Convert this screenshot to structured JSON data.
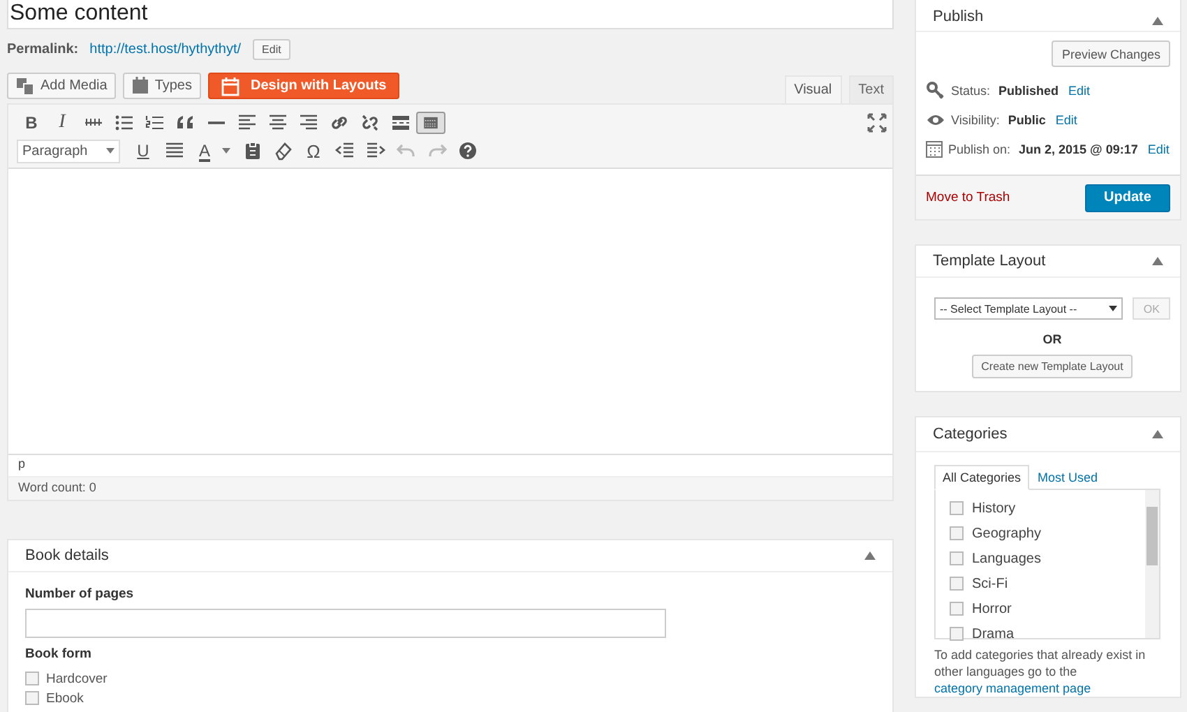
{
  "title_field": {
    "value": "Some content"
  },
  "permalink": {
    "label": "Permalink:",
    "url": "http://test.host/hythythyt/",
    "edit": "Edit"
  },
  "media_buttons": [
    {
      "kind": "media",
      "label": "Add Media"
    },
    {
      "kind": "types",
      "label": "Types"
    },
    {
      "kind": "layouts",
      "label": "Design with Layouts"
    }
  ],
  "editor_tabs": [
    {
      "label": "Visual",
      "selected": true
    },
    {
      "label": "Text",
      "selected": false
    }
  ],
  "toolbar_row_1": [
    {
      "kind": "bold",
      "text": "B"
    },
    {
      "kind": "italic",
      "text": "I"
    },
    {
      "kind": "strike"
    },
    {
      "kind": "bullets"
    },
    {
      "kind": "numbers"
    },
    {
      "kind": "quote"
    },
    {
      "kind": "hr"
    },
    {
      "kind": "align-left"
    },
    {
      "kind": "align-center"
    },
    {
      "kind": "align-right"
    },
    {
      "kind": "link"
    },
    {
      "kind": "unlink"
    },
    {
      "kind": "more"
    },
    {
      "kind": "toggle",
      "selected": true
    }
  ],
  "toolbar_row_2": [
    {
      "kind": "format",
      "text": "Paragraph"
    },
    {
      "kind": "underline",
      "text": "U"
    },
    {
      "kind": "justify"
    },
    {
      "kind": "color",
      "text": "A"
    },
    {
      "kind": "paste"
    },
    {
      "kind": "eraser"
    },
    {
      "kind": "omega",
      "text": "Ω"
    },
    {
      "kind": "outdent"
    },
    {
      "kind": "indent"
    },
    {
      "kind": "undo",
      "disabled": true
    },
    {
      "kind": "redo",
      "disabled": true
    },
    {
      "kind": "help"
    }
  ],
  "editor_status": {
    "path": "p",
    "word_count": "Word count: 0"
  },
  "book_details": {
    "title": "Book details",
    "pages_label": "Number of pages",
    "form_label": "Book form",
    "forms": [
      {
        "label": "Hardcover",
        "checked": false
      },
      {
        "label": "Ebook",
        "checked": false
      }
    ]
  },
  "publish": {
    "title": "Publish",
    "preview": "Preview Changes",
    "rows": [
      {
        "kind": "status",
        "label": "Status:",
        "value": "Published",
        "edit": "Edit"
      },
      {
        "kind": "visibility",
        "label": "Visibility:",
        "value": "Public",
        "edit": "Edit"
      },
      {
        "kind": "date",
        "label": "Publish on:",
        "value": "Jun 2, 2015 @ 09:17",
        "edit": "Edit"
      }
    ],
    "trash": "Move to Trash",
    "update": "Update"
  },
  "template_layout": {
    "title": "Template Layout",
    "select": "-- Select Template Layout --",
    "ok": "OK",
    "or": "OR",
    "create": "Create new Template Layout"
  },
  "categories": {
    "title": "Categories",
    "tabs": [
      {
        "label": "All Categories",
        "selected": true
      },
      {
        "label": "Most Used",
        "selected": false
      }
    ],
    "items": [
      {
        "label": "History",
        "checked": false
      },
      {
        "label": "Geography",
        "checked": false
      },
      {
        "label": "Languages",
        "checked": false
      },
      {
        "label": "Sci-Fi",
        "checked": false
      },
      {
        "label": "Horror",
        "checked": false
      },
      {
        "label": "Drama",
        "checked": false
      }
    ],
    "note": "To add categories that already exist in other languages go to the",
    "note_link": "category management page"
  }
}
